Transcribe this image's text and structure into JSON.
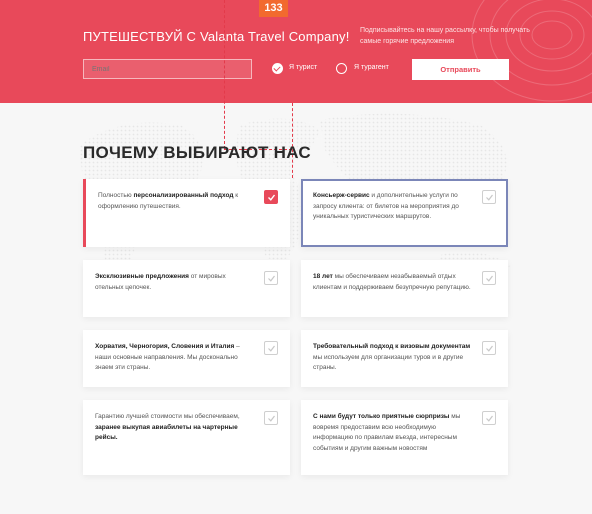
{
  "badge": "133",
  "banner": {
    "headline": "ПУТЕШЕСТВУЙ С Valanta Travel Company!",
    "subscribe_text": "Подписывайтесь на нашу рассылку, чтобы получать самые горячие предложения",
    "email_placeholder": "Email",
    "option_tourist": "Я турист",
    "option_agent": "Я турагент",
    "submit_label": "Отправить"
  },
  "section_title": "ПОЧЕМУ ВЫБИРАЮТ НАС",
  "cards": [
    {
      "pre": "Полностью ",
      "bold": "персонализированный подход",
      "post": " к оформлению путешествия."
    },
    {
      "pre": "",
      "bold": "Консьерж-сервис",
      "post": " и дополнительные услуги по запросу клиента: от билетов на мероприятия до уникальных туристических маршрутов."
    },
    {
      "pre": "",
      "bold": "Эксклюзивные предложения",
      "post": " от мировых отельных цепочек."
    },
    {
      "pre": "",
      "bold": "18 лет",
      "post": " мы обеспечиваем незабываемый отдых клиентам и поддерживаем безупречную репутацию."
    },
    {
      "pre": "",
      "bold": "Хорватия, Черногория, Словения и Италия",
      "post": " – наши основные направления. Мы досконально знаем эти страны."
    },
    {
      "pre": "",
      "bold": "Требовательный подход к визовым документам",
      "post": " мы используем для организации туров и в другие страны."
    },
    {
      "pre": "Гарантию лучшей стоимости мы обеспечиваем, ",
      "bold": "заранее выкупая авиабилеты на чартерные рейсы.",
      "post": ""
    },
    {
      "pre": "",
      "bold": "С нами будут только приятные сюрпризы",
      "post": " мы вовремя предоставим всю необходимую информацию по правилам въезда, интересным событиям и другим важным новостям"
    }
  ],
  "colors": {
    "accent": "#e8495a",
    "badge": "#f26a2e",
    "selection": "#7b86b8"
  }
}
